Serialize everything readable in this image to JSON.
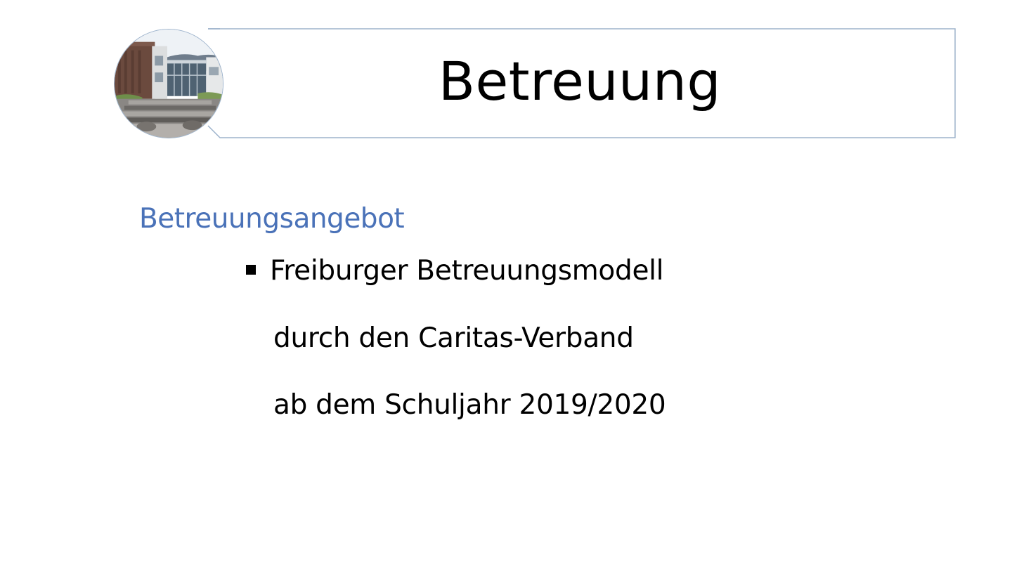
{
  "slide": {
    "title": "Betreuung",
    "photo": {
      "description_icon": "school-building-photo"
    },
    "section_heading": "Betreuungsangebot",
    "bullets": [
      {
        "text": "Freiburger Betreuungsmodell",
        "icon": "square-bullet-icon"
      }
    ],
    "continuation_lines": [
      "durch den Caritas-Verband",
      "ab dem Schuljahr 2019/2020"
    ]
  },
  "colors": {
    "heading_accent": "#4a72b8",
    "frame_border": "#9db3cc",
    "text": "#000000",
    "background": "#ffffff"
  }
}
